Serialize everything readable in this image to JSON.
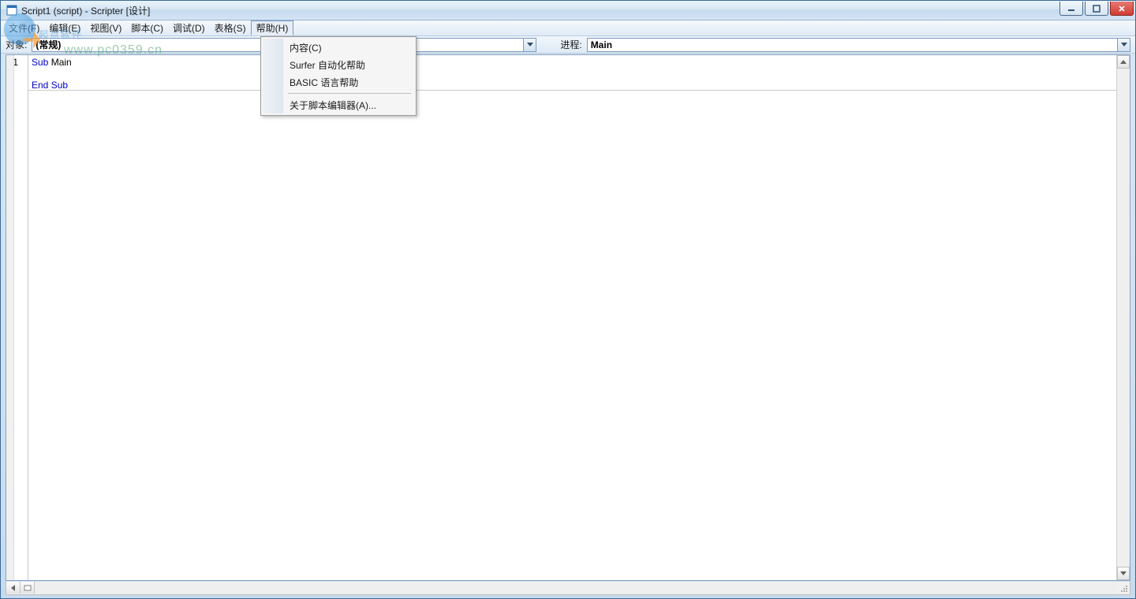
{
  "window": {
    "title": "Script1 (script) - Scripter [设计]"
  },
  "menu": {
    "file": "文件(F)",
    "edit": "编辑(E)",
    "view": "视图(V)",
    "script": "脚本(C)",
    "debug": "调试(D)",
    "sheet": "表格(S)",
    "help": "帮助(H)"
  },
  "help_menu": {
    "contents": "内容(C)",
    "surfer": "Surfer 自动化帮助",
    "basic": "BASIC 语言帮助",
    "about": "关于脚本编辑器(A)..."
  },
  "objbar": {
    "object_label": "对象:",
    "object_value": "(常规)",
    "proc_label": "进程:",
    "proc_value": "Main"
  },
  "editor": {
    "line_number": "1",
    "line1_kw1": "Sub",
    "line1_id": " Main",
    "line3_kw1": "End",
    "line3_kw2": " Sub"
  },
  "watermark": {
    "text": "起点软件",
    "url": "www.pc0359.cn"
  }
}
